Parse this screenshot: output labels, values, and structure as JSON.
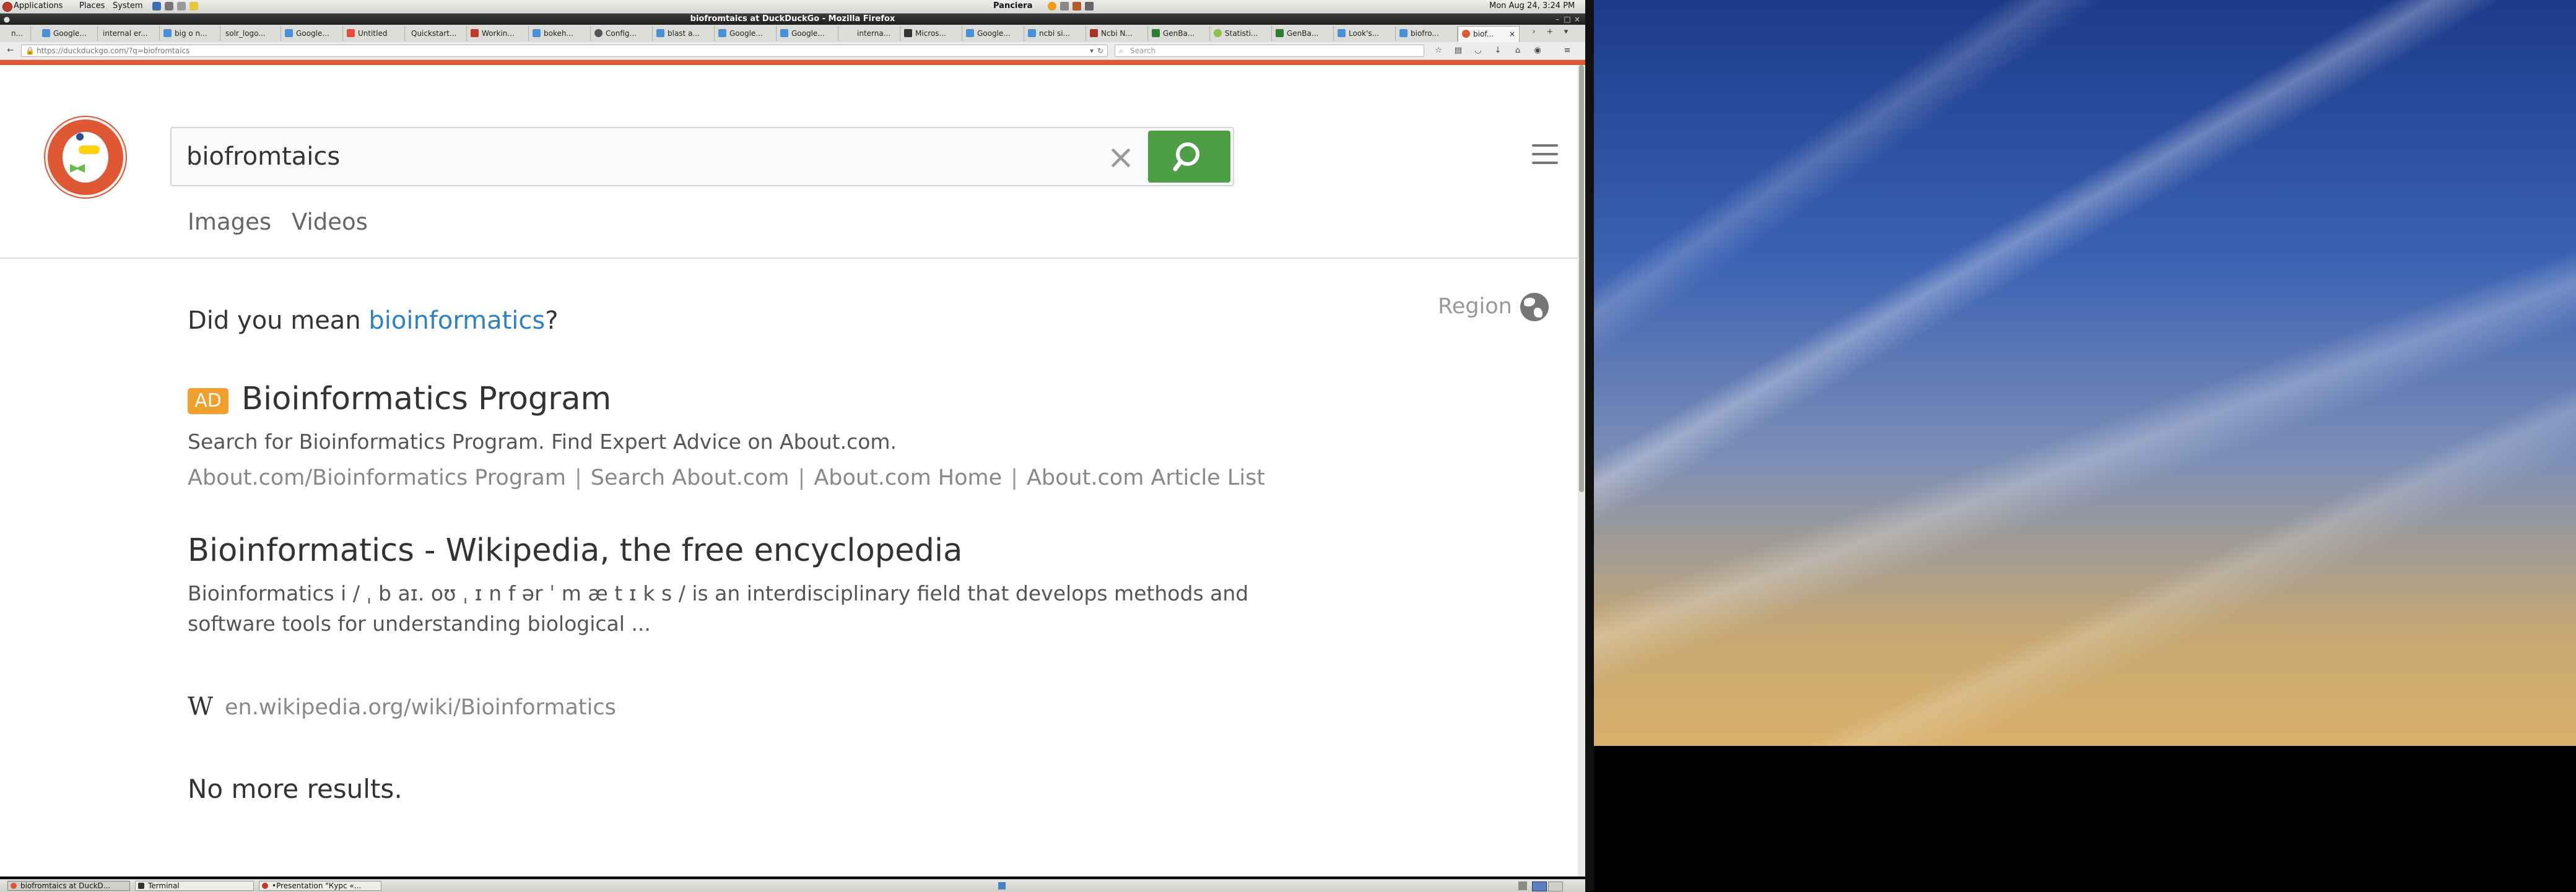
{
  "top_panel": {
    "menus": [
      "Applications",
      "Places",
      "System"
    ],
    "user": "Panciera",
    "clock": "Mon Aug 24,  3:24 PM"
  },
  "window": {
    "title": "biofromtaics at DuckDuckGo - Mozilla Firefox",
    "tabs": [
      {
        "label": "n..."
      },
      {
        "label": "Google..."
      },
      {
        "label": "internal er..."
      },
      {
        "label": "big o n..."
      },
      {
        "label": "solr_logo..."
      },
      {
        "label": "Google..."
      },
      {
        "label": "Untitled"
      },
      {
        "label": "Quickstart..."
      },
      {
        "label": "Workin..."
      },
      {
        "label": "bokeh..."
      },
      {
        "label": "Config..."
      },
      {
        "label": "blast a..."
      },
      {
        "label": "Google..."
      },
      {
        "label": "Google..."
      },
      {
        "label": "interna..."
      },
      {
        "label": "Micros..."
      },
      {
        "label": "Google..."
      },
      {
        "label": "ncbi si..."
      },
      {
        "label": "Ncbi N..."
      },
      {
        "label": "GenBa..."
      },
      {
        "label": "Statisti..."
      },
      {
        "label": "GenBa..."
      },
      {
        "label": "Look's..."
      },
      {
        "label": "biofro..."
      },
      {
        "label": "biof..."
      }
    ],
    "url": "https://duckduckgo.com/?q=biofromtaics",
    "search_placeholder": "Search"
  },
  "page": {
    "query": "biofromtaics",
    "nav_tabs": [
      "Images",
      "Videos"
    ],
    "did_you_mean_prefix": "Did you mean ",
    "did_you_mean_term": "bioinformatics",
    "did_you_mean_suffix": "?",
    "region_label": "Region",
    "ad": {
      "badge": "AD",
      "title": "Bioinformatics Program",
      "snippet": "Search for Bioinformatics Program. Find Expert Advice on About.com.",
      "links": [
        "About.com/Bioinformatics Program",
        "Search About.com",
        "About.com Home",
        "About.com Article List"
      ],
      "separator": "|"
    },
    "result": {
      "title": "Bioinformatics - Wikipedia, the free encyclopedia",
      "snippet_line1": "Bioinformatics i / ˌ b aɪ. oʊ ˌ ɪ n f ər ˈ m æ t ɪ k s / is an interdisciplinary field that develops methods and",
      "snippet_line2": "software tools for understanding biological ...",
      "site_icon": "W",
      "url": "en.wikipedia.org/wiki/Bioinformatics"
    },
    "no_more": "No more results."
  },
  "taskbar": {
    "items": [
      "biofromtaics at DuckD...",
      "Terminal",
      "•Presentation \"Курс «..."
    ]
  },
  "colors": {
    "ddg_orange": "#de5833",
    "search_green": "#4e9e45",
    "link_blue": "#2f81c6",
    "ad_badge": "#f0a02a"
  }
}
